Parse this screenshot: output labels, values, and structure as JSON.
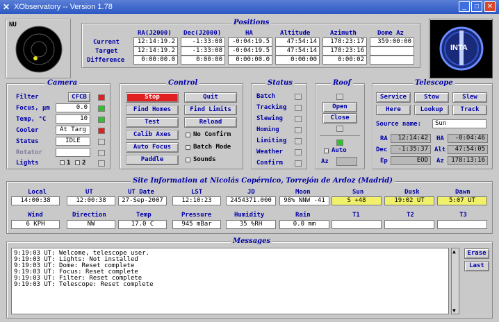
{
  "window": {
    "title": "XObservatory -- Version 1.78",
    "min": "_",
    "max": "□",
    "close": "✕"
  },
  "compass": {
    "label": "NU"
  },
  "positions": {
    "title": "Positions",
    "headers": [
      "RA(J2000)",
      "Dec(J2000)",
      "HA",
      "Altitude",
      "Azimuth",
      "Dome Az"
    ],
    "rows": [
      {
        "label": "Current",
        "values": [
          "12:14:19.2",
          "-1:33:08",
          "-0:04:19.5",
          "47:54:14",
          "178:23:17",
          "359:00:00"
        ]
      },
      {
        "label": "Target",
        "values": [
          "12:14:19.2",
          "-1:33:08",
          "-0:04:19.5",
          "47:54:14",
          "178:23:16",
          ""
        ]
      },
      {
        "label": "Difference",
        "values": [
          "0:00:00.0",
          "0:00:00",
          "0:00:00.0",
          "0:00:00",
          "0:00:02",
          ""
        ]
      }
    ]
  },
  "logo": {
    "text": "INTA"
  },
  "camera": {
    "title": "Camera",
    "filter_label": "Filter",
    "filter_value": "CFCB",
    "focus_label": "Focus, µm",
    "focus_value": "0.0",
    "temp_label": "Temp, °C",
    "temp_value": "10",
    "cooler_label": "Cooler",
    "cooler_value": "At Targ",
    "status_label": "Status",
    "status_value": "IDLE",
    "rotator_label": "Rotator",
    "rotator_value": "",
    "lights_label": "Lights",
    "light1": "1",
    "light2": "2"
  },
  "control": {
    "title": "Control",
    "stop": "Stop",
    "quit": "Quit",
    "find_homes": "Find Homes",
    "find_limits": "Find Limits",
    "test": "Test",
    "reload": "Reload",
    "calib_axes": "Calib Axes",
    "no_confirm": "No Confirm",
    "auto_focus": "Auto Focus",
    "batch_mode": "Batch Mode",
    "paddle": "Paddle",
    "sounds": "Sounds"
  },
  "status": {
    "title": "Status",
    "items": [
      "Batch",
      "Tracking",
      "Slewing",
      "Homing",
      "Limiting",
      "Weather",
      "Confirm"
    ]
  },
  "roof": {
    "title": "Roof",
    "open": "Open",
    "close": "Close",
    "auto": "Auto",
    "az": "Az"
  },
  "telescope": {
    "title": "Telescope",
    "service": "Service",
    "stow": "Stow",
    "slew": "Slew",
    "here": "Here",
    "lookup": "Lookup",
    "track": "Track",
    "source_label": "Source name:",
    "source_value": "Sun",
    "ra_label": "RA",
    "ra_value": "12:14:42",
    "ha_label": "HA",
    "ha_value": "-0:04:46",
    "dec_label": "Dec",
    "dec_value": "-1:35:37",
    "alt_label": "Alt",
    "alt_value": "47:54:05",
    "ep_label": "Ep",
    "ep_value": "EOD",
    "az_label": "Az",
    "az_value": "178:13:16"
  },
  "site": {
    "title": "Site Information at Nicolás Copérnico, Torrejón de Ardoz (Madrid)",
    "row1_labels": [
      "Local",
      "UT",
      "UT Date",
      "LST",
      "JD",
      "Moon",
      "Sun",
      "Dusk",
      "Dawn"
    ],
    "row1_values": [
      "14:00:38",
      "12:00:38",
      "27-Sep-2007",
      "12:10:23",
      "2454371.000",
      "98% NNW -41",
      "S +48",
      "19:02 UT",
      "5:07 UT"
    ],
    "row2_labels": [
      "Wind",
      "Direction",
      "Temp",
      "Pressure",
      "Humidity",
      "Rain",
      "T1",
      "T2",
      "T3"
    ],
    "row2_values": [
      "6 KPH",
      "NW",
      "17.0 C",
      "945 mBar",
      "35 %RH",
      "0.0 mm",
      "",
      "",
      ""
    ]
  },
  "messages": {
    "title": "Messages",
    "lines": [
      "9:19:03 UT: Welcome, telescope user.",
      "9:19:03 UT: Lights: Not installed",
      "9:19:03 UT: Dome: Reset complete",
      "9:19:03 UT: Focus: Reset complete",
      "9:19:03 UT: Filter: Reset complete",
      "9:19:03 UT: Telescope: Reset complete"
    ],
    "erase": "Erase",
    "last": "Last"
  }
}
